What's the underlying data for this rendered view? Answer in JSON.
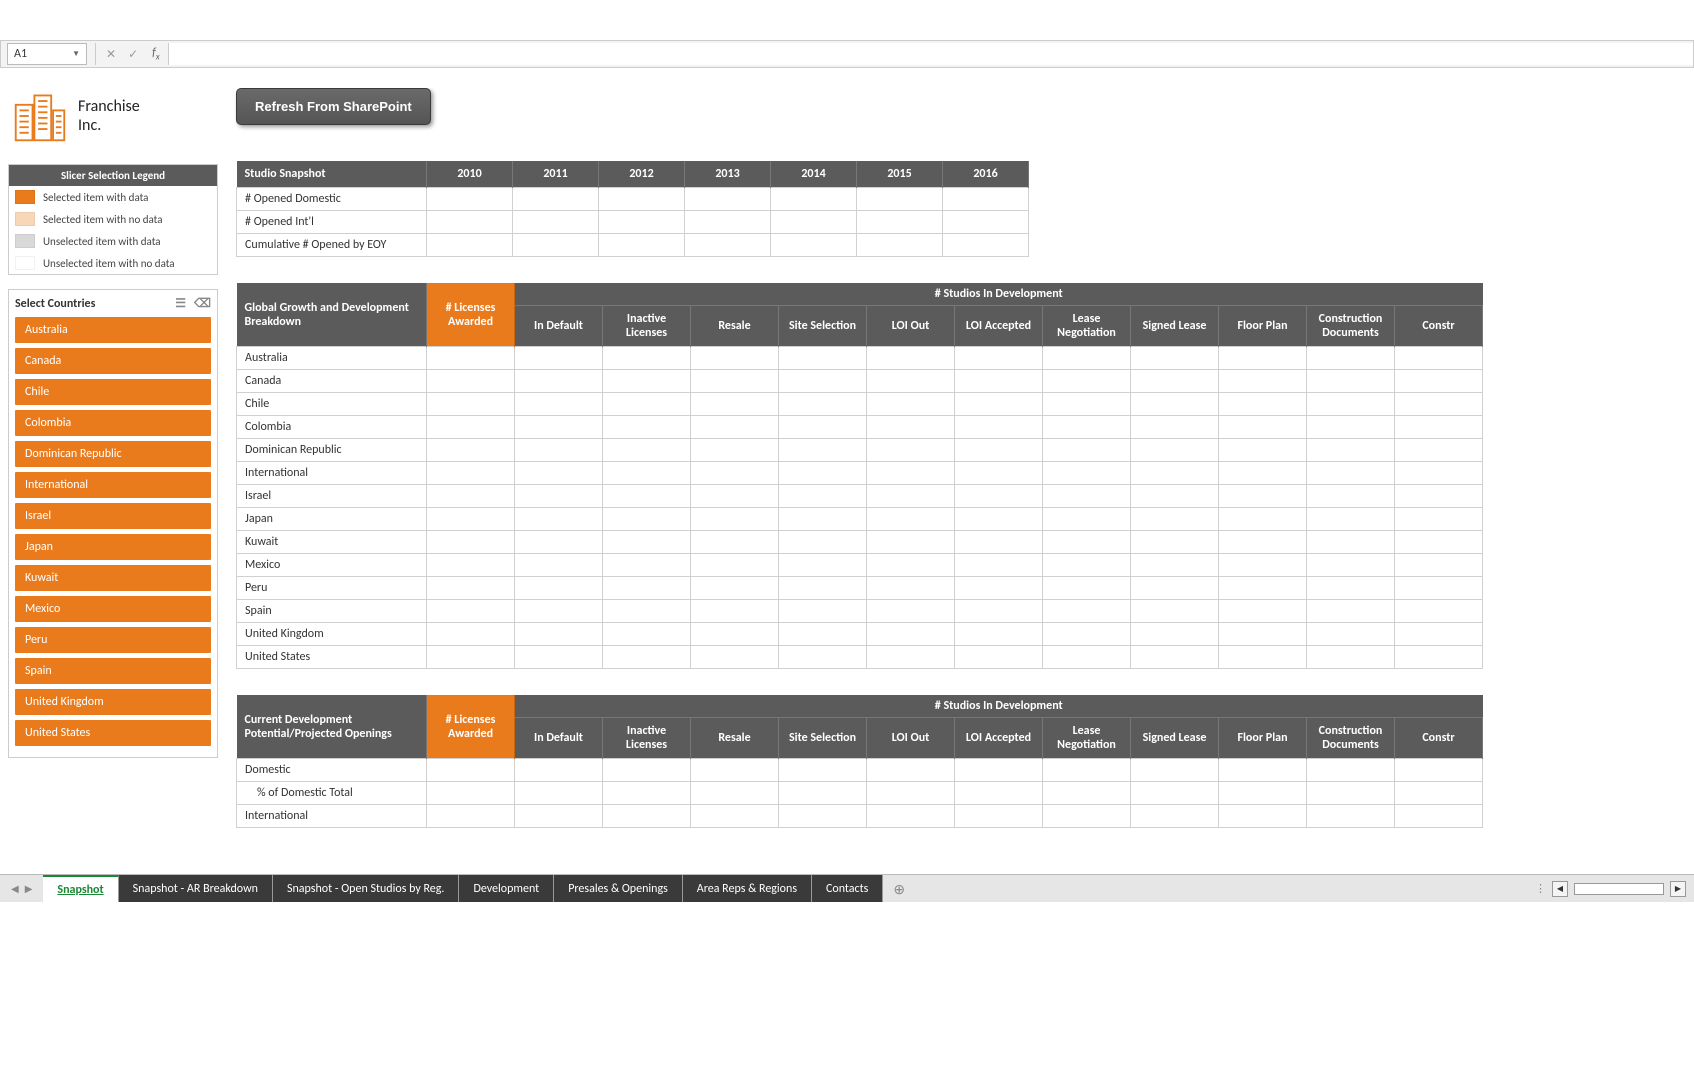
{
  "formula_bar": {
    "cell_ref": "A1",
    "value": ""
  },
  "company": {
    "line1": "Franchise",
    "line2": "Inc."
  },
  "refresh_button": "Refresh From SharePoint",
  "legend": {
    "title": "Slicer Selection Legend",
    "rows": [
      {
        "color": "#e97b1d",
        "label": "Selected item with data"
      },
      {
        "color": "#f8d7b8",
        "label": "Selected item with no data"
      },
      {
        "color": "#d9d9d9",
        "label": "Unselected item with data"
      },
      {
        "color": "#ffffff",
        "label": "Unselected item with no data"
      }
    ]
  },
  "slicer": {
    "title": "Select Countries",
    "items": [
      "Australia",
      "Canada",
      "Chile",
      "Colombia",
      "Dominican Republic",
      "International",
      "Israel",
      "Japan",
      "Kuwait",
      "Mexico",
      "Peru",
      "Spain",
      "United Kingdom",
      "United States"
    ]
  },
  "snapshot_table": {
    "title": "Studio Snapshot",
    "years": [
      "2010",
      "2011",
      "2012",
      "2013",
      "2014",
      "2015",
      "2016"
    ],
    "rows": [
      "# Opened Domestic",
      "# Opened Int'l",
      "Cumulative # Opened by EOY"
    ]
  },
  "dev_table": {
    "row_header_1": "Global Growth and Development Breakdown",
    "licenses_header": "# Licenses Awarded",
    "span_header": "# Studios In Development",
    "columns": [
      "In Default",
      "Inactive Licenses",
      "Resale",
      "Site Selection",
      "LOI Out",
      "LOI Accepted",
      "Lease Negotiation",
      "Signed Lease",
      "Floor Plan",
      "Construction Documents",
      "Constr"
    ],
    "rows": [
      "Australia",
      "Canada",
      "Chile",
      "Colombia",
      "Dominican Republic",
      "International",
      "Israel",
      "Japan",
      "Kuwait",
      "Mexico",
      "Peru",
      "Spain",
      "United Kingdom",
      "United States"
    ]
  },
  "potential_table": {
    "row_header_1": "Current Development Potential/Projected Openings",
    "licenses_header": "# Licenses Awarded",
    "span_header": "# Studios In Development",
    "columns": [
      "In Default",
      "Inactive Licenses",
      "Resale",
      "Site Selection",
      "LOI Out",
      "LOI Accepted",
      "Lease Negotiation",
      "Signed Lease",
      "Floor Plan",
      "Construction Documents",
      "Constr"
    ],
    "rows": [
      "Domestic",
      "   % of Domestic Total",
      "International"
    ]
  },
  "tabs": {
    "active": "Snapshot",
    "others": [
      "Snapshot - AR Breakdown",
      "Snapshot - Open Studios by Reg.",
      "Development",
      "Presales & Openings",
      "Area Reps & Regions",
      "Contacts"
    ]
  }
}
